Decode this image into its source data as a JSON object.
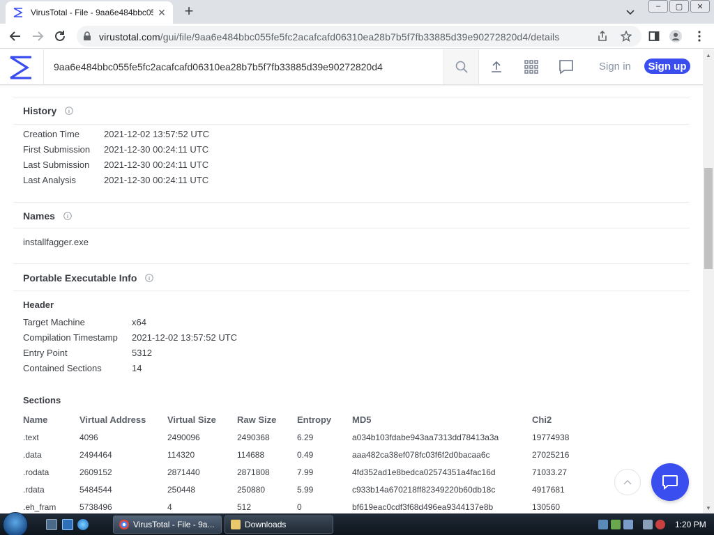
{
  "browser": {
    "tab_title": "VirusTotal - File - 9aa6e484bbc05",
    "url_domain": "virustotal.com",
    "url_path": "/gui/file/9aa6e484bbc055fe5fc2acafcafd06310ea28b7b5f7fb33885d39e90272820d4/details"
  },
  "vt": {
    "search_value": "9aa6e484bbc055fe5fc2acafcafd06310ea28b7b5f7fb33885d39e90272820d4",
    "sign_in": "Sign in",
    "sign_up": "Sign up",
    "brand_color": "#3a4ef0"
  },
  "history": {
    "title": "History",
    "rows": [
      {
        "label": "Creation Time",
        "value": "2021-12-02 13:57:52 UTC"
      },
      {
        "label": "First Submission",
        "value": "2021-12-30 00:24:11 UTC"
      },
      {
        "label": "Last Submission",
        "value": "2021-12-30 00:24:11 UTC"
      },
      {
        "label": "Last Analysis",
        "value": "2021-12-30 00:24:11 UTC"
      }
    ]
  },
  "names": {
    "title": "Names",
    "items": [
      "installfagger.exe"
    ]
  },
  "pe": {
    "title": "Portable Executable Info",
    "header_title": "Header",
    "header_rows": [
      {
        "label": "Target Machine",
        "value": "x64"
      },
      {
        "label": "Compilation Timestamp",
        "value": "2021-12-02 13:57:52 UTC"
      },
      {
        "label": "Entry Point",
        "value": "5312"
      },
      {
        "label": "Contained Sections",
        "value": "14"
      }
    ],
    "sections_title": "Sections",
    "columns": [
      "Name",
      "Virtual Address",
      "Virtual Size",
      "Raw Size",
      "Entropy",
      "MD5",
      "Chi2"
    ],
    "sections": [
      [
        ".text",
        "4096",
        "2490096",
        "2490368",
        "6.29",
        "a034b103fdabe943aa7313dd78413a3a",
        "19774938"
      ],
      [
        ".data",
        "2494464",
        "114320",
        "114688",
        "0.49",
        "aaa482ca38ef078fc03f6f2d0bacaa6c",
        "27025216"
      ],
      [
        ".rodata",
        "2609152",
        "2871440",
        "2871808",
        "7.99",
        "4fd352ad1e8bedca02574351a4fac16d",
        "71033.27"
      ],
      [
        ".rdata",
        "5484544",
        "250448",
        "250880",
        "5.99",
        "c933b14a670218ff82349220b60db18c",
        "4917681"
      ],
      [
        ".eh_fram",
        "5738496",
        "4",
        "512",
        "0",
        "bf619eac0cdf3f68d496ea9344137e8b",
        "130560"
      ]
    ]
  },
  "taskbar": {
    "tasks": [
      "VirusTotal - File - 9a...",
      "Downloads"
    ],
    "clock": "1:20 PM"
  }
}
